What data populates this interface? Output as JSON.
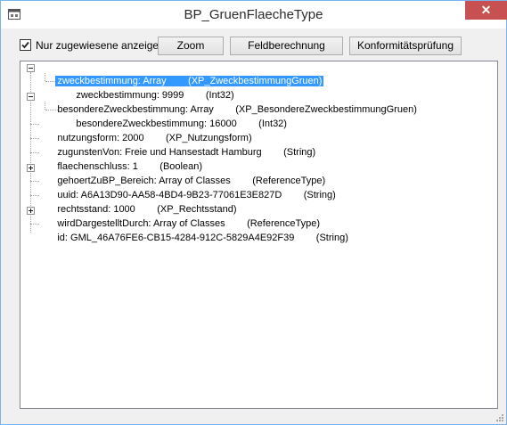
{
  "window": {
    "title": "BP_GruenFlaecheType",
    "close_glyph": "✕"
  },
  "toolbar": {
    "checkbox_label": "Nur zugewiesene anzeigen",
    "checkbox_checked": true,
    "zoom_label": "Zoom",
    "feld_label": "Feldberechnung",
    "konform_label": "Konformitätsprüfung"
  },
  "tree": {
    "nodes": [
      {
        "text": "zweckbestimmung: Array        (XP_ZweckbestimmungGruen)",
        "expanded": true,
        "selected": true
      },
      {
        "text": "zweckbestimmung: 9999        (Int32)"
      },
      {
        "text": "besondereZweckbestimmung: Array        (XP_BesondereZweckbestimmungGruen)",
        "expanded": true
      },
      {
        "text": "besondereZweckbestimmung: 16000        (Int32)"
      },
      {
        "text": "nutzungsform: 2000        (XP_Nutzungsform)"
      },
      {
        "text": "zugunstenVon: Freie und Hansestadt Hamburg        (String)"
      },
      {
        "text": "flaechenschluss: 1        (Boolean)"
      },
      {
        "text": "gehoertZuBP_Bereich: Array of Classes        (ReferenceType)",
        "expanded": false
      },
      {
        "text": "uuid: A6A13D90-AA58-4BD4-9B23-77061E3E827D        (String)"
      },
      {
        "text": "rechtsstand: 1000        (XP_Rechtsstand)"
      },
      {
        "text": "wirdDargestelltDurch: Array of Classes        (ReferenceType)",
        "expanded": false
      },
      {
        "text": "id: GML_46A76FE6-CB15-4284-912C-5829A4E92F39        (String)"
      }
    ]
  },
  "colors": {
    "selection": "#3399ff",
    "close_button": "#c75050",
    "window_border": "#7ab4ee"
  }
}
